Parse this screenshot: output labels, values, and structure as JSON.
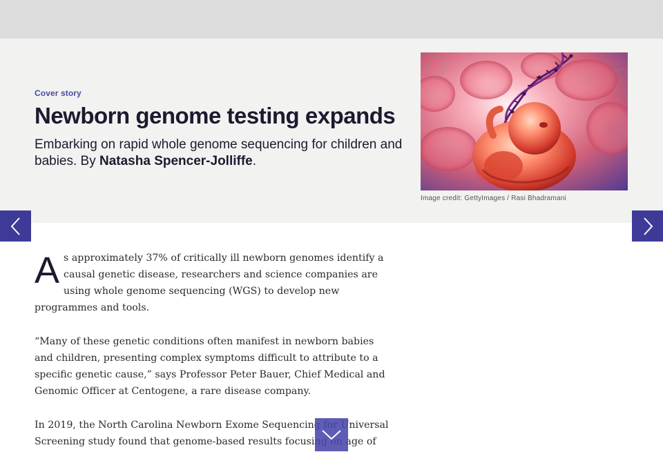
{
  "hero": {
    "kicker": "Cover story",
    "headline": "Newborn genome testing expands",
    "standfirst": "Embarking on rapid whole genome sequencing for children and babies. By ",
    "author": "Natasha Spencer-Jolliffe",
    "standfirst_end": ".",
    "image_credit": "Image credit: GettyImages / Rasi Bhadramani"
  },
  "article": {
    "dropcap": "A",
    "paragraphs": [
      "s approximately 37% of critically ill newborn genomes identify a causal genetic disease, researchers and science companies are using whole genome sequencing (WGS) to develop new programmes and tools.",
      "“Many of these genetic conditions often manifest in newborn babies and children, presenting complex symptoms difficult to attribute to a specific genetic cause,” says Professor Peter Bauer, Chief Medical and Genomic Officer at Centogene, a rare disease company.",
      "In 2019, the North Carolina Newborn Exome Sequencing for Universal Screening study found that genome-based results focusing on age of"
    ]
  },
  "icons": {
    "prev": "chevron-left-icon",
    "next": "chevron-right-icon",
    "down": "chevron-down-icon"
  },
  "colors": {
    "accent": "#3d3b97",
    "kicker": "#4b4aa3",
    "headline": "#1b1a2e",
    "hero_bg": "#f2f2f1",
    "top_bar": "#dcdcdc"
  }
}
